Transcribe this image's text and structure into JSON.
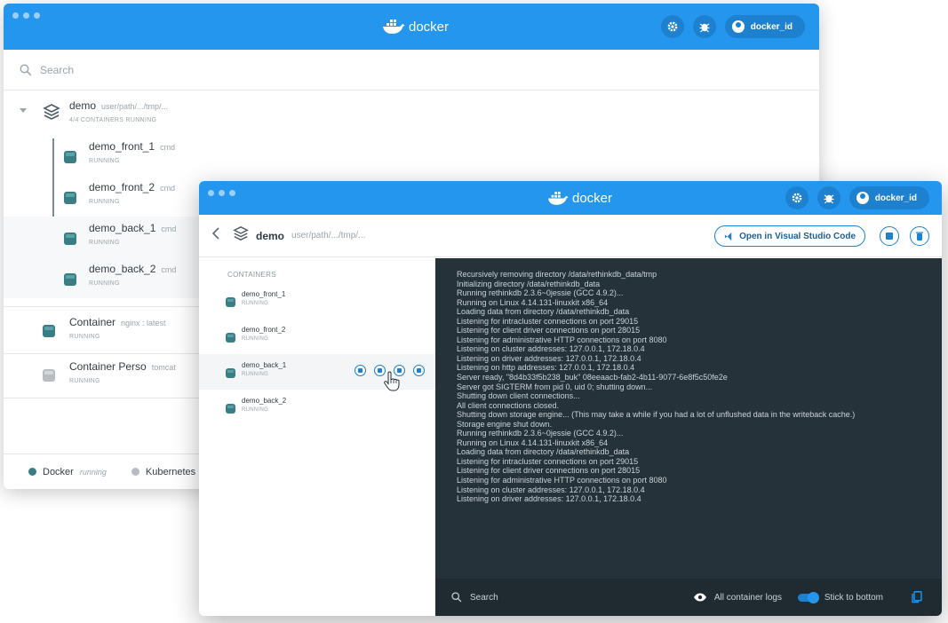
{
  "brand": {
    "name": "docker",
    "accent": "#2496ed",
    "user": "docker_id"
  },
  "back_window": {
    "search_placeholder": "Search",
    "stack": {
      "name": "demo",
      "path": "user/path/.../tmp/...",
      "status": "4/4 CONTAINERS RUNNING"
    },
    "stack_containers": [
      {
        "name": "demo_front_1",
        "cmd": "cmd",
        "status": "RUNNING"
      },
      {
        "name": "demo_front_2",
        "cmd": "cmd",
        "status": "RUNNING"
      },
      {
        "name": "demo_back_1",
        "cmd": "cmd",
        "status": "RUNNING"
      },
      {
        "name": "demo_back_2",
        "cmd": "cmd",
        "status": "RUNNING"
      }
    ],
    "containers": [
      {
        "name": "Container",
        "image": "nginx : latest",
        "status": "RUNNING"
      },
      {
        "name": "Container Perso",
        "image": "tomcat",
        "status": "RUNNING"
      }
    ],
    "footer": {
      "docker_label": "Docker",
      "docker_state": "running",
      "kubernetes_label": "Kubernetes"
    }
  },
  "front_window": {
    "title": "demo",
    "path": "user/path/.../tmp/...",
    "vscode_label": "Open in Visual Studio Code",
    "containers_header": "CONTAINERS",
    "containers": [
      {
        "name": "demo_front_1",
        "status": "RUNNING"
      },
      {
        "name": "demo_front_2",
        "status": "RUNNING"
      },
      {
        "name": "demo_back_1",
        "status": "RUNNING"
      },
      {
        "name": "demo_back_2",
        "status": "RUNNING"
      }
    ],
    "logs": [
      "Recursively removing directory /data/rethinkdb_data/tmp",
      "Initializing directory /data/rethinkdb_data",
      "Running rethinkdb 2.3.6~0jessie (GCC 4.9.2)...",
      "Running on Linux 4.14.131-linuxkit x86_64",
      "Loading data from directory /data/rethinkdb_data",
      "Listening for intracluster connections on port 29015",
      "Listening for client driver connections on port 28015",
      "Listening for administrative HTTP connections on port 8080",
      "Listening on cluster addresses: 127.0.0.1, 172.18.0.4",
      "Listening on driver addresses: 127.0.0.1, 172.18.0.4",
      "Listening on http addresses: 127.0.0.1, 172.18.0.4",
      "Server ready, \"8d4b33f5b238_buk\" 08eeaacb-fab2-4b11-9077-6e8f5c50fe2e",
      "Server got SIGTERM from pid 0, uid 0; shutting down...",
      "Shutting down client connections...",
      "All client connections closed.",
      "Shutting down storage engine... (This may take a while if you had a lot of unflushed data in the writeback cache.)",
      "Storage engine shut down.",
      "Running rethinkdb 2.3.6~0jessie (GCC 4.9.2)...",
      "Running on Linux 4.14.131-linuxkit x86_64",
      "Loading data from directory /data/rethinkdb_data",
      "Listening for intracluster connections on port 29015",
      "Listening for client driver connections on port 28015",
      "Listening for administrative HTTP connections on port 8080",
      "Listening on cluster addresses: 127.0.0.1, 172.18.0.4",
      "Listening on driver addresses: 127.0.0.1, 172.18.0.4"
    ],
    "log_footer": {
      "search_placeholder": "Search",
      "all_logs_label": "All container logs",
      "stick_label": "Stick to bottom",
      "stick_enabled": true
    }
  }
}
